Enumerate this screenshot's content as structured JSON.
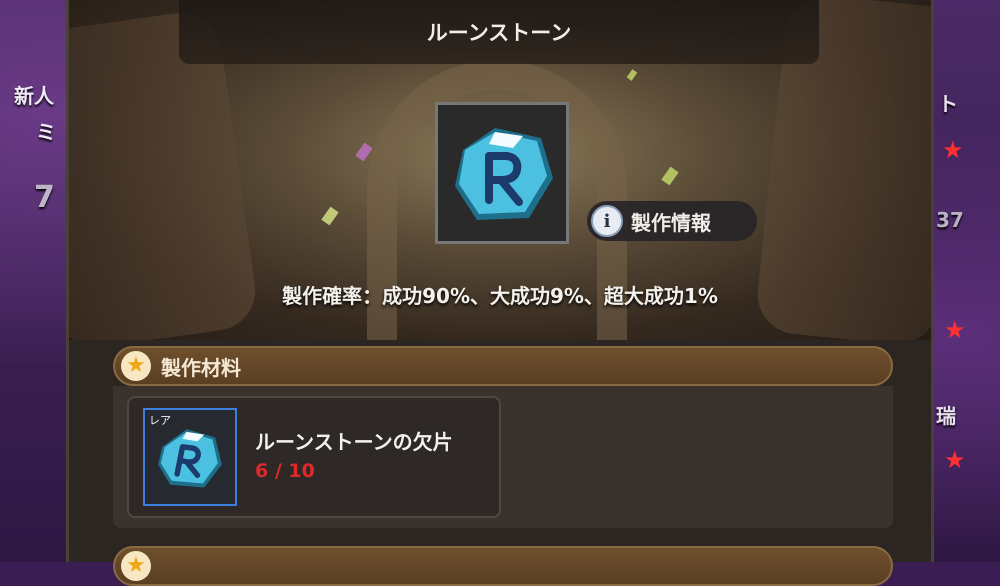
{
  "title": "ルーンストーン",
  "info_button": {
    "label": "製作情報",
    "icon": "info-icon"
  },
  "craft_rate": "製作確率：成功90%、大成功9%、超大成功1%",
  "materials_section": {
    "title": "製作材料",
    "icon": "star-icon",
    "items": [
      {
        "rarity": "レア",
        "name": "ルーンストーンの欠片",
        "count": "6 / 10",
        "count_color": "#e02828",
        "frame_color": "#3d7fe0"
      }
    ]
  },
  "background_hud": {
    "left_texts": [
      "新人",
      "ミ",
      "7"
    ],
    "right_texts": [
      "ト",
      "37",
      "瑞"
    ]
  },
  "colors": {
    "rune_blue": "#4cc0e0",
    "accent_brown": "#6e4f2d"
  }
}
